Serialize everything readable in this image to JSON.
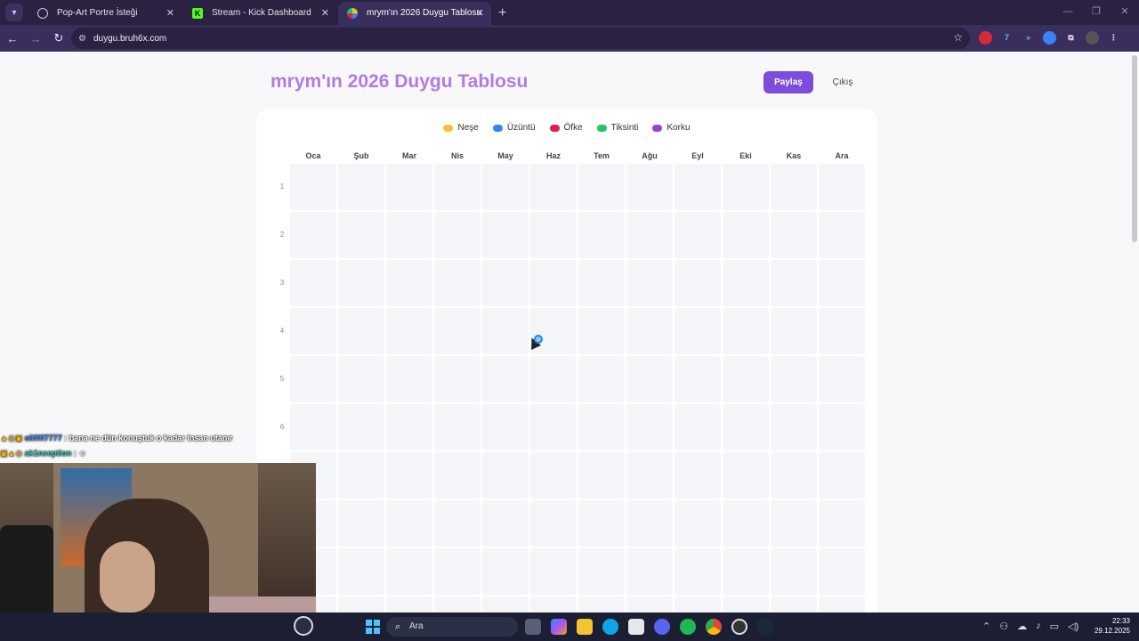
{
  "browser": {
    "tabs": [
      {
        "title": "Pop-Art Portre İsteği",
        "favicon": "globe-icon",
        "active": false
      },
      {
        "title": "Stream - Kick Dashboard",
        "favicon": "kick-icon",
        "active": false
      },
      {
        "title": "mrym'ın 2026 Duygu Tablosu",
        "favicon": "duygu-icon",
        "active": true
      }
    ],
    "url": "duygu.bruh6x.com"
  },
  "page": {
    "title": "mrym'ın 2026 Duygu Tablosu",
    "share_label": "Paylaş",
    "exit_label": "Çıkış",
    "legend": [
      {
        "label": "Neşe",
        "color": "#f4c430"
      },
      {
        "label": "Üzüntü",
        "color": "#3b82f6"
      },
      {
        "label": "Öfke",
        "color": "#e11d48"
      },
      {
        "label": "Tiksinti",
        "color": "#22c55e"
      },
      {
        "label": "Korku",
        "color": "#9b3fd8"
      }
    ],
    "months": [
      "Oca",
      "Şub",
      "Mar",
      "Nis",
      "May",
      "Haz",
      "Tem",
      "Ağu",
      "Eyl",
      "Eki",
      "Kas",
      "Ara"
    ],
    "days": [
      "1",
      "2",
      "3",
      "4",
      "5",
      "6",
      "",
      "",
      "",
      ""
    ]
  },
  "chat": [
    {
      "user": "eliffff7777",
      "message": "bana ne dün konuştuk o kadar insan utanır"
    },
    {
      "user": "ak1nception",
      "message": ""
    }
  ],
  "taskbar": {
    "search_label": "Ara",
    "time": "22:33",
    "date": "29.12.2025"
  }
}
